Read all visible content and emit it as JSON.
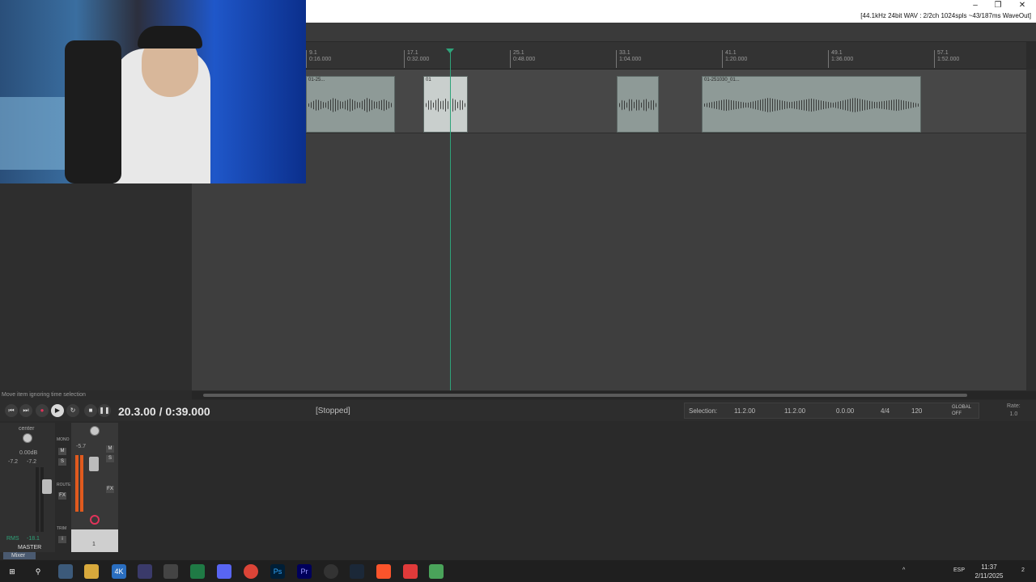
{
  "window": {
    "audio_info": "[44.1kHz 24bit WAV : 2/2ch 1024spls ~43/187ms WaveOut]",
    "min": "–",
    "restore": "❐",
    "close": "✕"
  },
  "ruler": {
    "marks": [
      {
        "bar": "9.1",
        "time": "0:16.000"
      },
      {
        "bar": "17.1",
        "time": "0:32.000"
      },
      {
        "bar": "25.1",
        "time": "0:48.000"
      },
      {
        "bar": "33.1",
        "time": "1:04.000"
      },
      {
        "bar": "41.1",
        "time": "1:20.000"
      },
      {
        "bar": "49.1",
        "time": "1:36.000"
      },
      {
        "bar": "57.1",
        "time": "1:52.000"
      }
    ]
  },
  "items": [
    {
      "label": "01-25..."
    },
    {
      "label": "01"
    },
    {
      "label": ""
    },
    {
      "label": "01-251030_01..."
    }
  ],
  "status_hint": "Move item ignoring time selection",
  "transport": {
    "time": "20.3.00 / 0:39.000",
    "state": "[Stopped]",
    "selection_label": "Selection:",
    "sel_start": "11.2.00",
    "sel_end": "11.2.00",
    "sel_len": "0.0.00",
    "time_sig": "4/4",
    "bpm": "120",
    "global": "GLOBAL",
    "global_state": "OFF",
    "rate_label": "Rate:",
    "rate_value": "1.0"
  },
  "mixer": {
    "master_pan": "center",
    "master_db": "0.00dB",
    "master_peak_l": "-7.2",
    "master_peak_r": "-7.2",
    "rms_label": "RMS",
    "rms_value": "-18.1",
    "master_label": "MASTER",
    "mono": "MONO",
    "m": "M",
    "s": "S",
    "route": "ROUTE",
    "fx": "FX",
    "trim": "TRIM",
    "info": "i",
    "track_number": "1",
    "track_db": "-5.7",
    "tab_label": "Mixer"
  },
  "taskbar": {
    "lang": "ESP",
    "time": "11:37",
    "date": "2/11/2025",
    "notifications": "2"
  },
  "colors": {
    "accent": "#2fa37a",
    "record": "#e0335a",
    "meter": "#e05a1e"
  }
}
